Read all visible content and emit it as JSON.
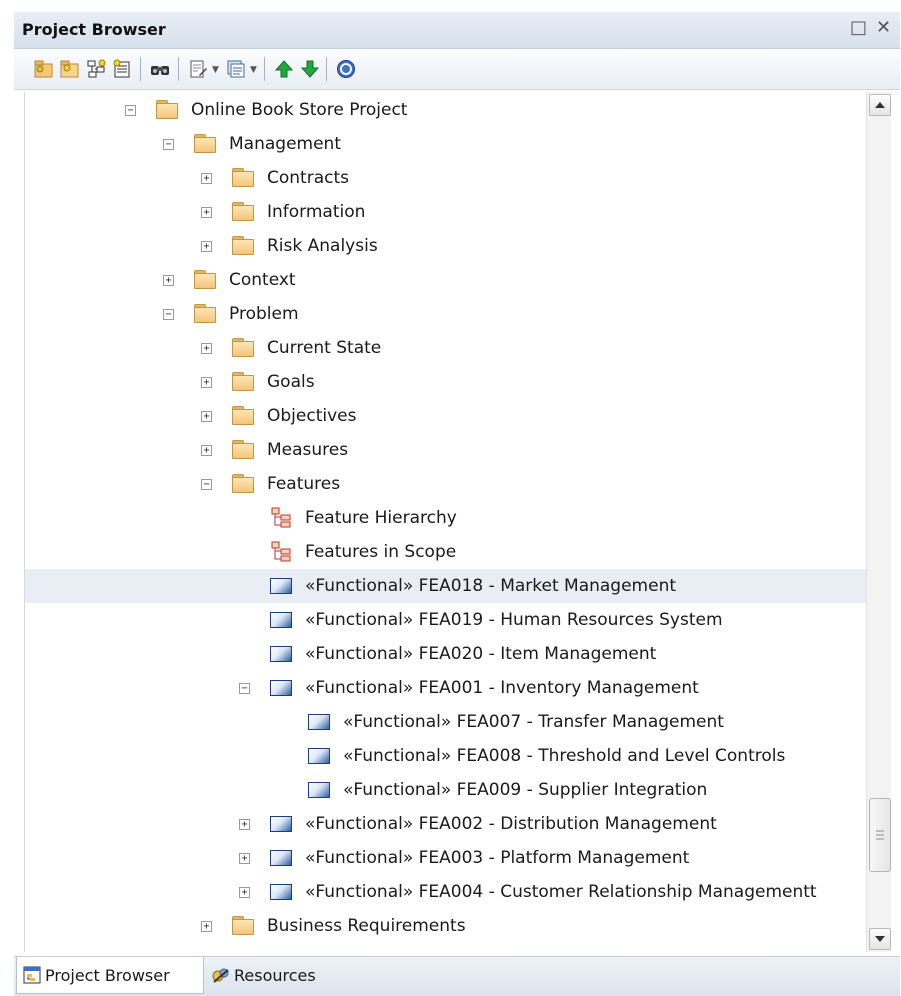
{
  "window": {
    "title": "Project Browser"
  },
  "toolbar": {
    "icons": [
      "new-package-icon",
      "new-view-icon",
      "new-diagram-icon",
      "new-element-icon",
      "find-icon",
      "edit-icon",
      "options-icon",
      "move-up-icon",
      "move-down-icon",
      "help-icon"
    ]
  },
  "tree": {
    "rows": [
      {
        "label": "Online Book Store Project",
        "level": 0,
        "kind": "folder",
        "toggle": "minus"
      },
      {
        "label": "Management",
        "level": 1,
        "kind": "folder",
        "toggle": "minus"
      },
      {
        "label": "Contracts",
        "level": 2,
        "kind": "folder",
        "toggle": "plus"
      },
      {
        "label": "Information",
        "level": 2,
        "kind": "folder",
        "toggle": "plus"
      },
      {
        "label": "Risk Analysis",
        "level": 2,
        "kind": "folder",
        "toggle": "plus"
      },
      {
        "label": "Context",
        "level": 1,
        "kind": "folder",
        "toggle": "plus"
      },
      {
        "label": "Problem",
        "level": 1,
        "kind": "folder",
        "toggle": "minus"
      },
      {
        "label": "Current State",
        "level": 2,
        "kind": "folder",
        "toggle": "plus"
      },
      {
        "label": "Goals",
        "level": 2,
        "kind": "folder",
        "toggle": "plus"
      },
      {
        "label": "Objectives",
        "level": 2,
        "kind": "folder",
        "toggle": "plus"
      },
      {
        "label": "Measures",
        "level": 2,
        "kind": "folder",
        "toggle": "plus"
      },
      {
        "label": "Features",
        "level": 2,
        "kind": "folder",
        "toggle": "minus"
      },
      {
        "label": "Feature Hierarchy",
        "level": 3,
        "kind": "diagram",
        "toggle": ""
      },
      {
        "label": "Features in Scope",
        "level": 3,
        "kind": "diagram",
        "toggle": ""
      },
      {
        "label": "«Functional» FEA018 - Market Management",
        "level": 3,
        "kind": "element",
        "toggle": "",
        "selected": true
      },
      {
        "label": "«Functional» FEA019 - Human Resources System",
        "level": 3,
        "kind": "element",
        "toggle": ""
      },
      {
        "label": "«Functional» FEA020 - Item Management",
        "level": 3,
        "kind": "element",
        "toggle": ""
      },
      {
        "label": "«Functional» FEA001 - Inventory Management",
        "level": 3,
        "kind": "element",
        "toggle": "minus"
      },
      {
        "label": "«Functional» FEA007 - Transfer Management",
        "level": 4,
        "kind": "element",
        "toggle": ""
      },
      {
        "label": "«Functional» FEA008 - Threshold and Level Controls",
        "level": 4,
        "kind": "element",
        "toggle": ""
      },
      {
        "label": "«Functional» FEA009 - Supplier Integration",
        "level": 4,
        "kind": "element",
        "toggle": ""
      },
      {
        "label": "«Functional» FEA002 - Distribution Management",
        "level": 3,
        "kind": "element",
        "toggle": "plus"
      },
      {
        "label": "«Functional» FEA003 - Platform Management",
        "level": 3,
        "kind": "element",
        "toggle": "plus"
      },
      {
        "label": "«Functional» FEA004 - Customer Relationship Managementt",
        "level": 3,
        "kind": "element",
        "toggle": "plus"
      },
      {
        "label": "Business Requirements",
        "level": 2,
        "kind": "folder",
        "toggle": "plus"
      }
    ]
  },
  "tabs": [
    {
      "label": "Project Browser",
      "icon": "project-browser-icon",
      "active": true
    },
    {
      "label": "Resources",
      "icon": "resources-icon",
      "active": false
    }
  ]
}
